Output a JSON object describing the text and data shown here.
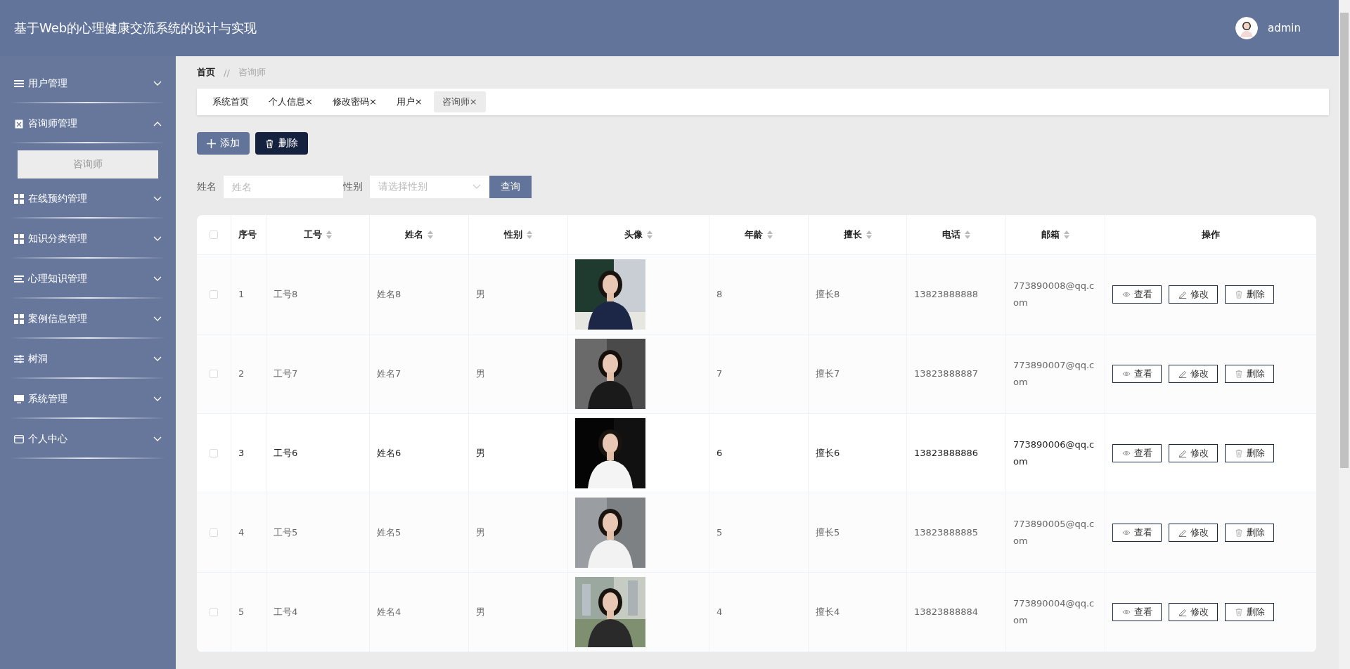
{
  "header": {
    "title": "基于Web的心理健康交流系统的设计与实现",
    "user": "admin"
  },
  "sidebar": {
    "items": [
      {
        "label": "用户管理",
        "kind": "list",
        "expanded": false
      },
      {
        "label": "咨询师管理",
        "kind": "clipboard",
        "expanded": true,
        "children": [
          {
            "label": "咨询师",
            "selected": true
          }
        ]
      },
      {
        "label": "在线预约管理",
        "kind": "grid",
        "expanded": false
      },
      {
        "label": "知识分类管理",
        "kind": "grid",
        "expanded": false
      },
      {
        "label": "心理知识管理",
        "kind": "lines",
        "expanded": false
      },
      {
        "label": "案例信息管理",
        "kind": "grid",
        "expanded": false
      },
      {
        "label": "树洞",
        "kind": "sliders",
        "expanded": false
      },
      {
        "label": "系统管理",
        "kind": "monitor",
        "expanded": false
      },
      {
        "label": "个人中心",
        "kind": "card",
        "expanded": false
      }
    ]
  },
  "breadcrumb": {
    "items": [
      "首页",
      "咨询师"
    ],
    "separator": "//"
  },
  "tabs": [
    {
      "label": "系统首页",
      "selected": false
    },
    {
      "label": "个人信息",
      "close": "×",
      "selected": false
    },
    {
      "label": "修改密码",
      "close": "×",
      "selected": false
    },
    {
      "label": "用户",
      "close": "×",
      "selected": false
    },
    {
      "label": "咨询师",
      "close": "×",
      "selected": true
    }
  ],
  "toolbar": [
    {
      "label": "添加",
      "kind": "add"
    },
    {
      "label": "删除",
      "kind": "delete"
    }
  ],
  "search": {
    "fields": [
      {
        "label": "姓名",
        "placeholder": "姓名",
        "kind": "text"
      },
      {
        "label": "性别",
        "placeholder": "请选择性别",
        "kind": "select"
      }
    ],
    "button": "查询"
  },
  "table": {
    "all_checked": false,
    "columns": [
      {
        "label": "序号",
        "sortable": false
      },
      {
        "label": "工号",
        "sortable": true
      },
      {
        "label": "姓名",
        "sortable": true
      },
      {
        "label": "性别",
        "sortable": true
      },
      {
        "label": "头像",
        "sortable": true
      },
      {
        "label": "年龄",
        "sortable": true
      },
      {
        "label": "擅长",
        "sortable": true
      },
      {
        "label": "电话",
        "sortable": true
      },
      {
        "label": "邮箱",
        "sortable": true
      },
      {
        "label": "操作",
        "sortable": false
      }
    ],
    "rows": [
      {
        "checked": false,
        "hovered": false,
        "cells": [
          "1",
          "工号8",
          "姓名8",
          "男",
          {
            "kind": "picture"
          },
          "8",
          "擅长8",
          "13823888888",
          "773890008@qq.com"
        ],
        "actions": [
          {
            "label": "查看",
            "kind": "view"
          },
          {
            "label": "修改",
            "kind": "edit"
          },
          {
            "label": "删除",
            "kind": "delete"
          }
        ]
      },
      {
        "checked": false,
        "hovered": false,
        "cells": [
          "2",
          "工号7",
          "姓名7",
          "男",
          {
            "kind": "picture"
          },
          "7",
          "擅长7",
          "13823888887",
          "773890007@qq.com"
        ],
        "actions": [
          {
            "label": "查看",
            "kind": "view"
          },
          {
            "label": "修改",
            "kind": "edit"
          },
          {
            "label": "删除",
            "kind": "delete"
          }
        ]
      },
      {
        "checked": false,
        "hovered": true,
        "cells": [
          "3",
          "工号6",
          "姓名6",
          "男",
          {
            "kind": "picture"
          },
          "6",
          "擅长6",
          "13823888886",
          "773890006@qq.com"
        ],
        "actions": [
          {
            "label": "查看",
            "kind": "view"
          },
          {
            "label": "修改",
            "kind": "edit"
          },
          {
            "label": "删除",
            "kind": "delete"
          }
        ]
      },
      {
        "checked": false,
        "hovered": false,
        "cells": [
          "4",
          "工号5",
          "姓名5",
          "男",
          {
            "kind": "picture"
          },
          "5",
          "擅长5",
          "13823888885",
          "773890005@qq.com"
        ],
        "actions": [
          {
            "label": "查看",
            "kind": "view"
          },
          {
            "label": "修改",
            "kind": "edit"
          },
          {
            "label": "删除",
            "kind": "delete"
          }
        ]
      },
      {
        "checked": false,
        "hovered": false,
        "cells": [
          "5",
          "工号4",
          "姓名4",
          "男",
          {
            "kind": "picture"
          },
          "4",
          "擅长4",
          "13823888884",
          "773890004@qq.com"
        ],
        "actions": [
          {
            "label": "查看",
            "kind": "view"
          },
          {
            "label": "修改",
            "kind": "edit"
          },
          {
            "label": "删除",
            "kind": "delete"
          }
        ]
      }
    ]
  }
}
